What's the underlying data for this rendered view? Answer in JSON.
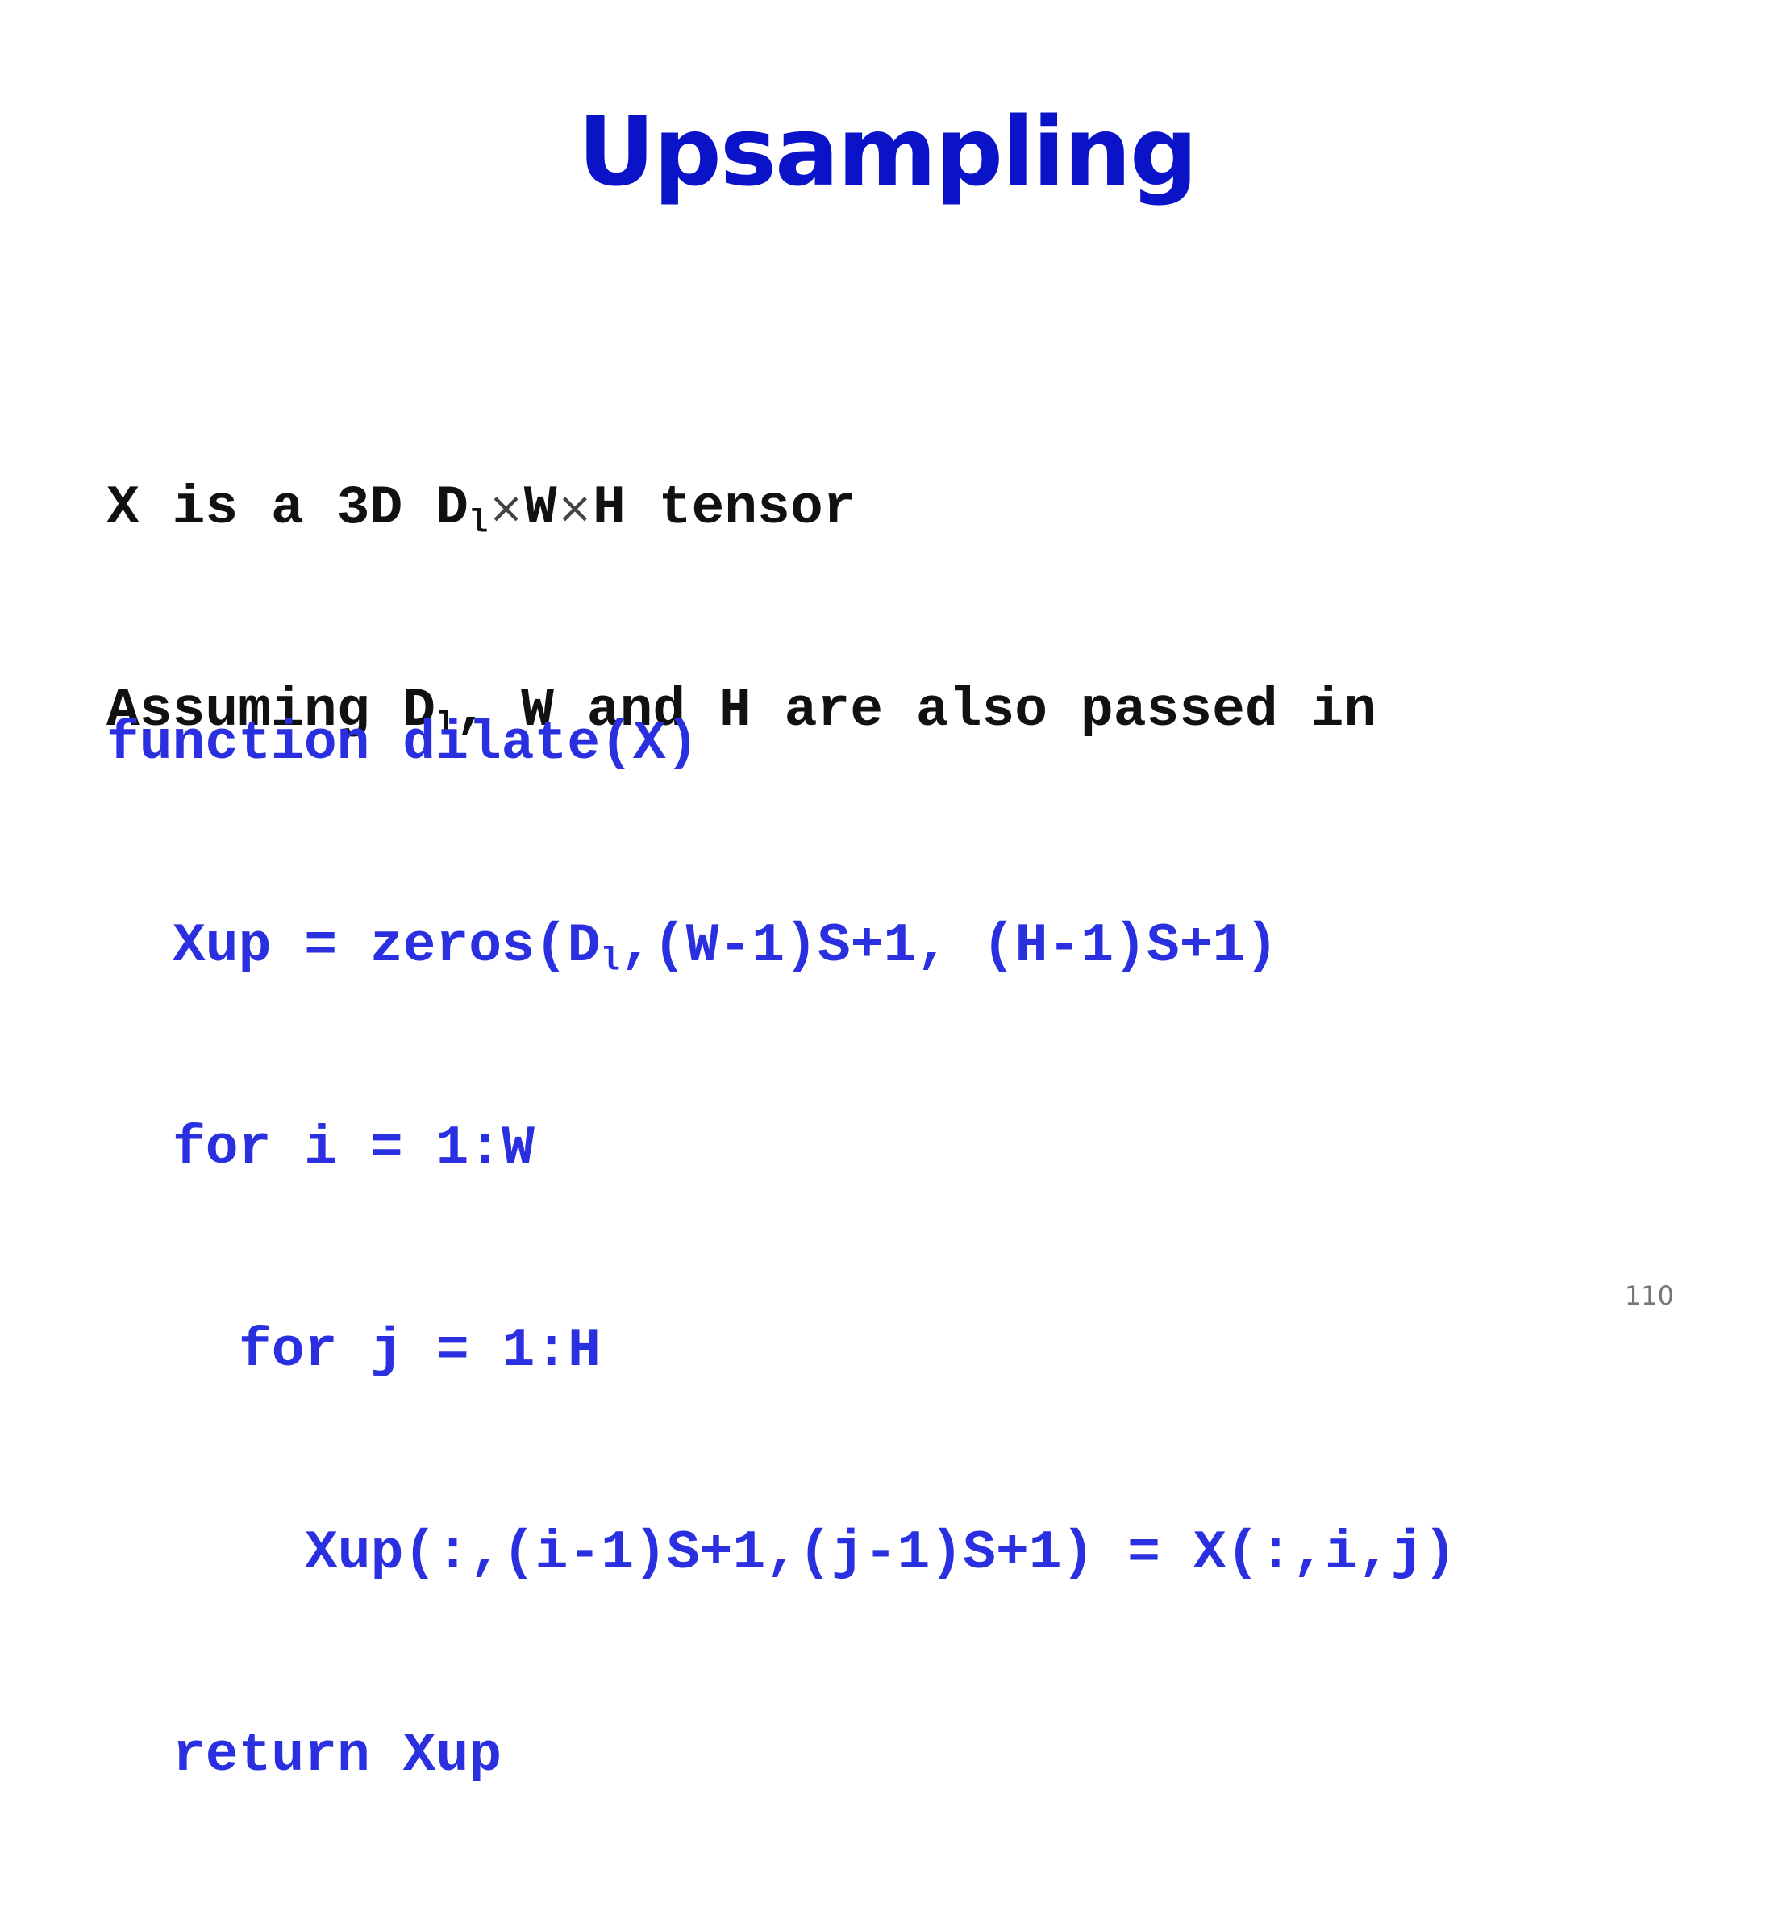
{
  "title": "Upsampling",
  "description": {
    "line1": {
      "prefix": "X is a 3D D",
      "sub1": "l",
      "times1": "×",
      "mid": "W",
      "times2": "×",
      "suffix": "H tensor"
    },
    "line2": {
      "prefix": "Assuming D",
      "sub": "l",
      "suffix": ", W and H are also passed in"
    }
  },
  "code": {
    "line1": "function dilate(X)",
    "line2": {
      "prefix": "Xup = zeros(D",
      "sub": "l",
      "suffix": ",(W-1)S+1, (H-1)S+1)"
    },
    "line3": "for i = 1:W",
    "line4": "for j = 1:H",
    "line5": "Xup(:,(i-1)S+1,(j-1)S+1) = X(:,i,j)",
    "line6": "return Xup"
  },
  "page_number": "110",
  "colors": {
    "title": "#0a13c8",
    "code": "#2a2fe0",
    "text": "#111111"
  }
}
